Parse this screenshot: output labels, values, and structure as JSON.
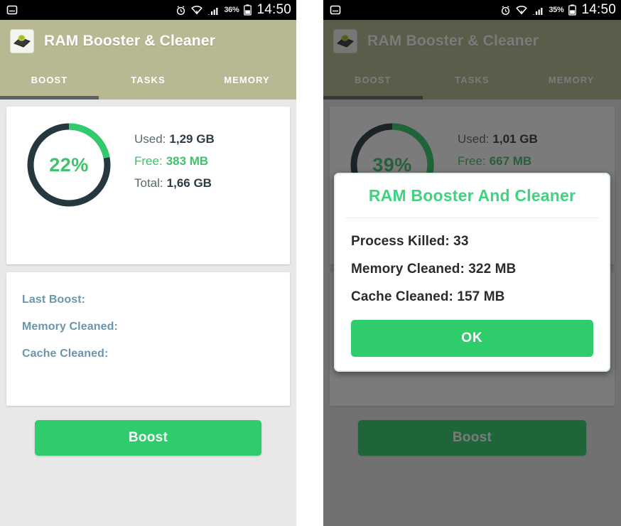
{
  "left_phone": {
    "status_bar": {
      "left_icon": "message-icon",
      "alarm_icon": "alarm-icon",
      "wifi_icon": "wifi-icon",
      "signal_icon": "signal-icon",
      "battery_percent": "36%",
      "battery_icon": "battery-icon",
      "clock": "14:50"
    },
    "app_bar": {
      "icon": "app-logo-icon",
      "title": "RAM Booster & Cleaner"
    },
    "tabs": [
      {
        "label": "BOOST",
        "active": true
      },
      {
        "label": "TASKS",
        "active": false
      },
      {
        "label": "MEMORY",
        "active": false
      }
    ],
    "memory_card": {
      "percent_label": "22%",
      "percent_value": 22,
      "rows": [
        {
          "label": "Used:",
          "value": "1,29 GB",
          "highlight": false
        },
        {
          "label": "Free:",
          "value": "383 MB",
          "highlight": true
        },
        {
          "label": "Total:",
          "value": "1,66 GB",
          "highlight": false
        }
      ]
    },
    "stats_card": {
      "lines": [
        "Last Boost:",
        "Memory Cleaned:",
        "Cache Cleaned:"
      ]
    },
    "boost_button": "Boost"
  },
  "right_phone": {
    "status_bar": {
      "left_icon": "message-icon",
      "alarm_icon": "alarm-icon",
      "wifi_icon": "wifi-icon",
      "signal_icon": "signal-icon",
      "battery_percent": "35%",
      "battery_icon": "battery-icon",
      "clock": "14:50"
    },
    "app_bar": {
      "icon": "app-logo-icon",
      "title": "RAM Booster & Cleaner"
    },
    "tabs": [
      {
        "label": "BOOST",
        "active": true
      },
      {
        "label": "TASKS",
        "active": false
      },
      {
        "label": "MEMORY",
        "active": false
      }
    ],
    "memory_card": {
      "percent_label": "39%",
      "percent_value": 39,
      "rows": [
        {
          "label": "Used:",
          "value": "1,01 GB",
          "highlight": false
        },
        {
          "label": "Free:",
          "value": "667 MB",
          "highlight": true
        }
      ]
    },
    "boost_button": "Boost",
    "dialog": {
      "title": "RAM Booster And Cleaner",
      "lines": [
        "Process Killed: 33",
        "Memory Cleaned: 322 MB",
        "Cache Cleaned: 157 MB"
      ],
      "ok_label": "OK"
    }
  },
  "colors": {
    "accent_green": "#2ecc6a",
    "ring_green": "#3ec26a",
    "ring_track": "#26373f",
    "appbar_khaki": "#b8b893",
    "tab_indicator": "#5d6266",
    "page_bg": "#e8e8e8",
    "stat_text": "#6a96ac",
    "dialog_title": "#3ed47f"
  }
}
